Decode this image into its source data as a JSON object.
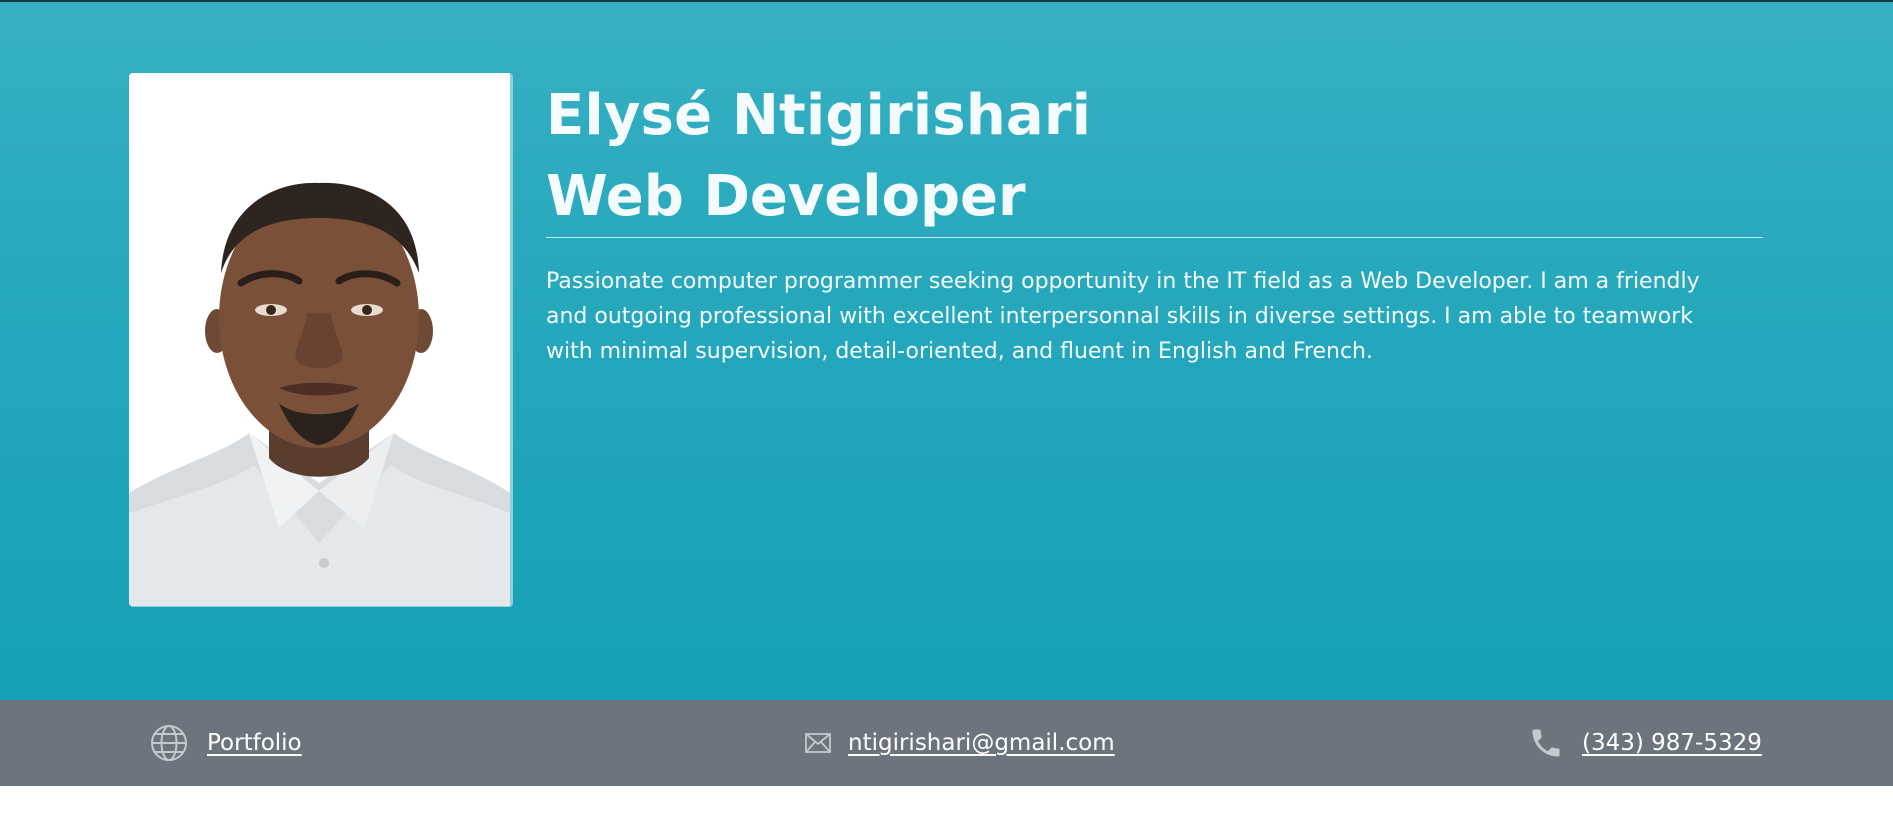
{
  "profile": {
    "name": "Elysé Ntigirishari",
    "role": "Web Developer",
    "bio": "Passionate computer programmer seeking opportunity in the IT field as a Web Developer. I am a friendly and outgoing professional with excellent interpersonnal skills in diverse settings. I am able to teamwork with minimal supervision, detail-oriented, and fluent in English and French."
  },
  "contacts": {
    "portfolio": {
      "label": "Portfolio",
      "icon": "globe-icon"
    },
    "email": {
      "label": "ntigirishari@gmail.com",
      "icon": "envelope-icon"
    },
    "phone": {
      "label": "(343) 987-5329",
      "icon": "phone-icon"
    }
  },
  "colors": {
    "hero_top": "#37b0c2",
    "hero_bottom": "#14a2b8",
    "footer": "#6c757d",
    "text": "#f4fbfc",
    "icon": "#c4c9ce"
  }
}
